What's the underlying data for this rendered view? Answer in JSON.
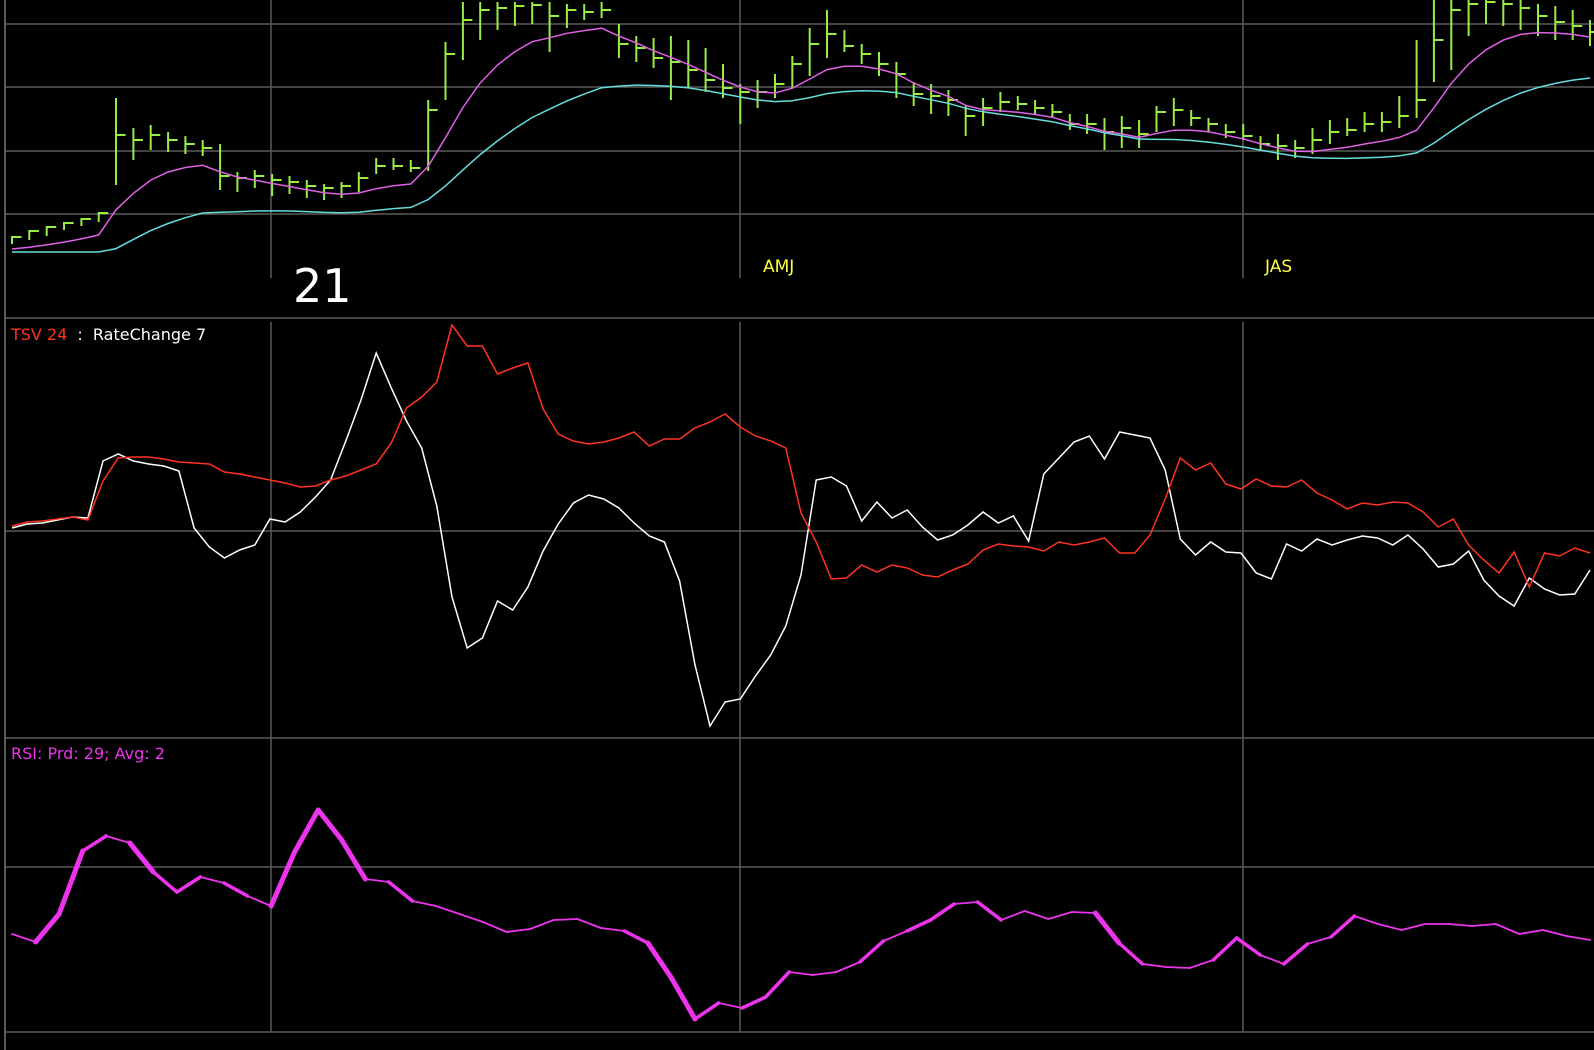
{
  "colors": {
    "background": "#000000",
    "grid": "#5a5a5a",
    "price_bars": "#99ee44",
    "fast_ma": "#e060e8",
    "slow_ma": "#66dddd",
    "tsv": "#ff3322",
    "ratechange": "#ffffff",
    "rsi": "#ee33ee",
    "period_label": "#ffff44",
    "year_label": "#ffffff",
    "title_separator": "#ffffff"
  },
  "labels": {
    "year": "21",
    "quarters": [
      "AMJ",
      "JAS"
    ]
  },
  "panels": {
    "indicator": {
      "tsv_label": "TSV 24",
      "separator": ":",
      "ratechange_label": "RateChange 7"
    },
    "rsi": {
      "label": "RSI: Prd: 29; Avg: 2"
    }
  },
  "chart_data": [
    {
      "type": "ohlc",
      "panel": "price",
      "bar_count": 92,
      "bars": [
        {
          "h": 244,
          "l": 236,
          "c": 237
        },
        {
          "h": 240,
          "l": 230,
          "c": 231
        },
        {
          "h": 236,
          "l": 226,
          "c": 227
        },
        {
          "h": 230,
          "l": 222,
          "c": 223
        },
        {
          "h": 226,
          "l": 218,
          "c": 219
        },
        {
          "h": 222,
          "l": 212,
          "c": 213
        },
        {
          "h": 185,
          "l": 98,
          "c": 135
        },
        {
          "h": 160,
          "l": 128,
          "c": 140
        },
        {
          "h": 150,
          "l": 125,
          "c": 135
        },
        {
          "h": 152,
          "l": 132,
          "c": 140
        },
        {
          "h": 154,
          "l": 136,
          "c": 144
        },
        {
          "h": 156,
          "l": 140,
          "c": 148
        },
        {
          "h": 190,
          "l": 144,
          "c": 176
        },
        {
          "h": 192,
          "l": 172,
          "c": 178
        },
        {
          "h": 188,
          "l": 170,
          "c": 176
        },
        {
          "h": 196,
          "l": 174,
          "c": 180
        },
        {
          "h": 194,
          "l": 176,
          "c": 182
        },
        {
          "h": 198,
          "l": 180,
          "c": 186
        },
        {
          "h": 200,
          "l": 184,
          "c": 188
        },
        {
          "h": 198,
          "l": 182,
          "c": 186
        },
        {
          "h": 192,
          "l": 172,
          "c": 178
        },
        {
          "h": 174,
          "l": 158,
          "c": 166
        },
        {
          "h": 170,
          "l": 158,
          "c": 166
        },
        {
          "h": 172,
          "l": 160,
          "c": 168
        },
        {
          "h": 171,
          "l": 100,
          "c": 110
        },
        {
          "h": 100,
          "l": 42,
          "c": 54
        },
        {
          "h": 60,
          "l": 2,
          "c": 20
        },
        {
          "h": 40,
          "l": 2,
          "c": 10
        },
        {
          "h": 30,
          "l": 2,
          "c": 8
        },
        {
          "h": 26,
          "l": 2,
          "c": 6
        },
        {
          "h": 24,
          "l": 2,
          "c": 5
        },
        {
          "h": 52,
          "l": 2,
          "c": 16
        },
        {
          "h": 28,
          "l": 4,
          "c": 10
        },
        {
          "h": 20,
          "l": 4,
          "c": 12
        },
        {
          "h": 18,
          "l": 2,
          "c": 10
        },
        {
          "h": 58,
          "l": 24,
          "c": 44
        },
        {
          "h": 62,
          "l": 36,
          "c": 48
        },
        {
          "h": 68,
          "l": 38,
          "c": 58
        },
        {
          "h": 100,
          "l": 36,
          "c": 62
        },
        {
          "h": 88,
          "l": 40,
          "c": 70
        },
        {
          "h": 92,
          "l": 48,
          "c": 80
        },
        {
          "h": 98,
          "l": 64,
          "c": 88
        },
        {
          "h": 124,
          "l": 84,
          "c": 92
        },
        {
          "h": 108,
          "l": 80,
          "c": 92
        },
        {
          "h": 98,
          "l": 74,
          "c": 84
        },
        {
          "h": 88,
          "l": 56,
          "c": 64
        },
        {
          "h": 76,
          "l": 28,
          "c": 44
        },
        {
          "h": 58,
          "l": 10,
          "c": 34
        },
        {
          "h": 52,
          "l": 30,
          "c": 46
        },
        {
          "h": 64,
          "l": 44,
          "c": 54
        },
        {
          "h": 76,
          "l": 52,
          "c": 64
        },
        {
          "h": 98,
          "l": 62,
          "c": 74
        },
        {
          "h": 106,
          "l": 82,
          "c": 94
        },
        {
          "h": 114,
          "l": 84,
          "c": 96
        },
        {
          "h": 116,
          "l": 90,
          "c": 100
        },
        {
          "h": 136,
          "l": 106,
          "c": 116
        },
        {
          "h": 126,
          "l": 98,
          "c": 108
        },
        {
          "h": 112,
          "l": 92,
          "c": 102
        },
        {
          "h": 110,
          "l": 96,
          "c": 104
        },
        {
          "h": 114,
          "l": 100,
          "c": 108
        },
        {
          "h": 118,
          "l": 104,
          "c": 112
        },
        {
          "h": 130,
          "l": 114,
          "c": 124
        },
        {
          "h": 134,
          "l": 114,
          "c": 124
        },
        {
          "h": 150,
          "l": 118,
          "c": 132
        },
        {
          "h": 148,
          "l": 116,
          "c": 128
        },
        {
          "h": 148,
          "l": 120,
          "c": 134
        },
        {
          "h": 132,
          "l": 106,
          "c": 112
        },
        {
          "h": 126,
          "l": 98,
          "c": 110
        },
        {
          "h": 126,
          "l": 110,
          "c": 118
        },
        {
          "h": 132,
          "l": 118,
          "c": 124
        },
        {
          "h": 138,
          "l": 124,
          "c": 132
        },
        {
          "h": 140,
          "l": 124,
          "c": 136
        },
        {
          "h": 150,
          "l": 136,
          "c": 144
        },
        {
          "h": 160,
          "l": 134,
          "c": 146
        },
        {
          "h": 158,
          "l": 140,
          "c": 148
        },
        {
          "h": 154,
          "l": 128,
          "c": 140
        },
        {
          "h": 144,
          "l": 120,
          "c": 132
        },
        {
          "h": 136,
          "l": 118,
          "c": 130
        },
        {
          "h": 132,
          "l": 112,
          "c": 124
        },
        {
          "h": 132,
          "l": 112,
          "c": 122
        },
        {
          "h": 128,
          "l": 96,
          "c": 116
        },
        {
          "h": 118,
          "l": 40,
          "c": 100
        },
        {
          "h": 82,
          "l": 0,
          "c": 40
        },
        {
          "h": 70,
          "l": 0,
          "c": 10
        },
        {
          "h": 36,
          "l": 0,
          "c": 4
        },
        {
          "h": 24,
          "l": 0,
          "c": 2
        },
        {
          "h": 26,
          "l": 0,
          "c": 4
        },
        {
          "h": 30,
          "l": 0,
          "c": 8
        },
        {
          "h": 36,
          "l": 4,
          "c": 16
        },
        {
          "h": 40,
          "l": 6,
          "c": 22
        },
        {
          "h": 40,
          "l": 10,
          "c": 26
        },
        {
          "h": 46,
          "l": 20,
          "c": 32
        }
      ]
    },
    {
      "type": "line",
      "panel": "indicator",
      "series": [
        {
          "name": "TSV 24",
          "values": [
            526,
            522,
            521,
            519,
            517,
            520,
            481,
            458,
            457,
            457,
            459,
            462,
            463,
            464,
            472,
            474,
            477,
            480,
            483,
            487,
            486,
            480,
            476,
            470,
            464,
            443,
            408,
            397,
            382,
            325,
            346,
            346,
            374,
            368,
            363,
            409,
            434,
            441,
            444,
            442,
            438,
            432,
            446,
            439,
            439,
            428,
            422,
            414,
            427,
            436,
            441,
            448,
            513,
            542,
            579,
            578,
            565,
            572,
            565,
            568,
            575,
            577,
            570,
            564,
            550,
            544,
            546,
            547,
            551,
            542,
            545,
            542,
            538,
            553,
            553,
            535,
            499,
            458,
            470,
            463,
            484,
            489,
            479,
            486,
            487,
            480,
            493,
            500,
            509,
            503,
            505,
            502,
            503,
            512,
            527,
            519,
            545,
            560,
            573,
            552,
            587,
            553,
            556,
            548,
            553
          ]
        },
        {
          "name": "RateChange 7",
          "values": [
            528,
            524,
            523,
            520,
            517,
            518,
            461,
            454,
            461,
            464,
            466,
            471,
            528,
            547,
            558,
            550,
            545,
            519,
            522,
            512,
            497,
            480,
            441,
            400,
            353,
            388,
            421,
            448,
            506,
            597,
            648,
            638,
            601,
            610,
            587,
            551,
            524,
            503,
            495,
            499,
            508,
            523,
            536,
            542,
            581,
            664,
            726,
            702,
            699,
            676,
            655,
            626,
            575,
            480,
            477,
            486,
            521,
            502,
            518,
            510,
            527,
            540,
            535,
            525,
            512,
            523,
            516,
            541,
            474,
            458,
            442,
            436,
            459,
            432,
            435,
            438,
            470,
            539,
            555,
            542,
            552,
            553,
            573,
            579,
            544,
            551,
            539,
            545,
            540,
            536,
            538,
            545,
            535,
            549,
            567,
            564,
            551,
            580,
            596,
            606,
            578,
            589,
            595,
            594,
            570
          ]
        }
      ]
    },
    {
      "type": "line",
      "panel": "rsi",
      "series": [
        {
          "name": "RSI: Prd: 29; Avg: 2",
          "values": [
            934,
            942,
            914,
            851,
            836,
            843,
            872,
            892,
            877,
            883,
            896,
            906,
            852,
            810,
            840,
            879,
            882,
            901,
            906,
            914,
            922,
            932,
            929,
            920,
            919,
            928,
            931,
            943,
            978,
            1019,
            1003,
            1008,
            997,
            972,
            975,
            972,
            962,
            941,
            931,
            920,
            904,
            902,
            920,
            911,
            919,
            912,
            913,
            943,
            964,
            967,
            968,
            960,
            938,
            955,
            964,
            944,
            937,
            916,
            924,
            930,
            924,
            924,
            926,
            924,
            934,
            930,
            936,
            940
          ]
        }
      ]
    }
  ]
}
